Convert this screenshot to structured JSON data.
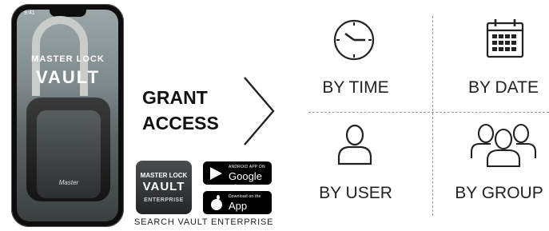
{
  "phone": {
    "time": "9:41",
    "brand_top": "MASTER LOCK",
    "brand_main": "VAULT",
    "lock_brand": "Master"
  },
  "grant_access": {
    "line1": "GRANT",
    "line2": "ACCESS"
  },
  "app_tile": {
    "line1": "MASTER LOCK",
    "line2": "VAULT",
    "line3": "ENTERPRISE"
  },
  "badges": {
    "google_small": "ANDROID APP ON",
    "google_big": "Google play",
    "apple_small": "Download on the",
    "apple_big": "App Store"
  },
  "search_text": "SEARCH VAULT ENTERPRISE",
  "options": [
    {
      "label": "BY TIME",
      "icon": "clock-icon"
    },
    {
      "label": "BY DATE",
      "icon": "calendar-icon"
    },
    {
      "label": "BY USER",
      "icon": "user-icon"
    },
    {
      "label": "BY GROUP",
      "icon": "group-icon"
    }
  ]
}
